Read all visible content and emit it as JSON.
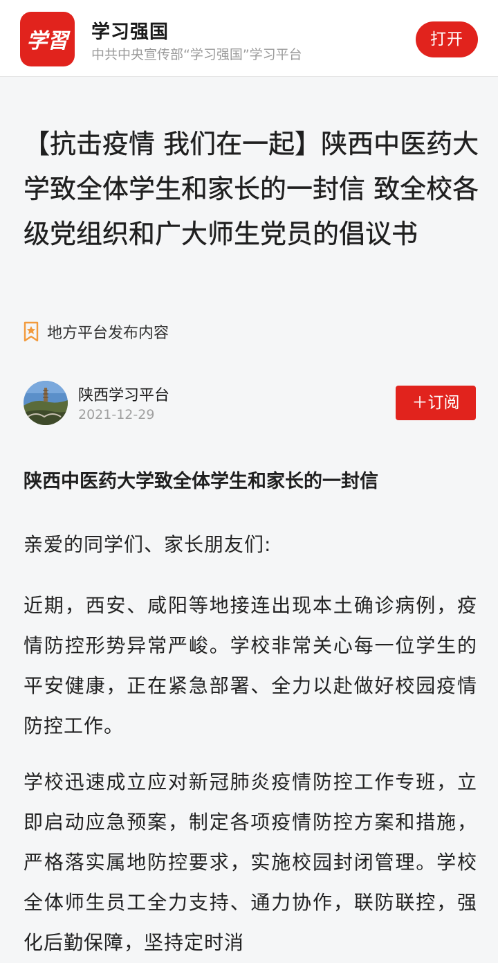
{
  "banner": {
    "logo_text": "学習",
    "app_name": "学习强国",
    "app_desc": "中共中央宣传部“学习强国”学习平台",
    "open_label": "打开"
  },
  "article": {
    "title": "【抗击疫情 我们在一起】陕西中医药大学致全体学生和家长的一封信 致全校各级党组织和广大师生党员的倡议书",
    "source_label": "地方平台发布内容",
    "author": {
      "name": "陕西学习平台",
      "date": "2021-12-29",
      "subscribe_label": "＋订阅"
    },
    "section_heading": "陕西中医药大学致全体学生和家长的一封信",
    "paragraphs": [
      "亲爱的同学们、家长朋友们:",
      "近期，西安、咸阳等地接连出现本土确诊病例，疫情防控形势异常严峻。学校非常关心每一位学生的平安健康，正在紧急部署、全力以赴做好校园疫情防控工作。",
      "学校迅速成立应对新冠肺炎疫情防控工作专班，立即启动应急预案，制定各项疫情防控方案和措施，严格落实属地防控要求，实施校园封闭管理。学校全体师生员工全力支持、通力协作，联防联控，强化后勤保障，坚持定时消"
    ]
  },
  "colors": {
    "brand_red": "#e1231d",
    "source_icon_orange": "#f29a3c"
  },
  "icons": {
    "source": "ribbon-star-icon",
    "logo": "xuexi-logo-icon"
  }
}
